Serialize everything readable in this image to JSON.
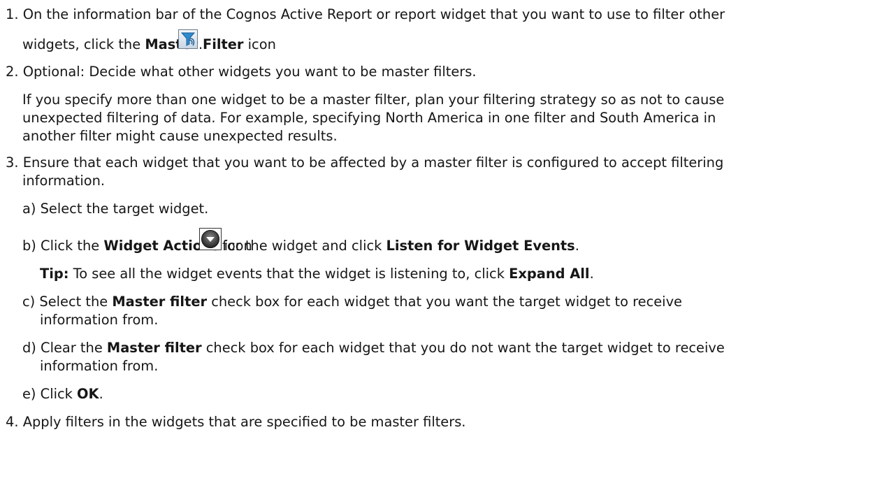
{
  "steps": {
    "s1": {
      "num": "1.",
      "line1": "On the information bar of the Cognos Active Report or report widget that you want to use to filter other",
      "line2_pre": "widgets, click the ",
      "line2_bold": "Master Filter",
      "line2_post": " icon",
      "line2_end": ".",
      "icon": "master-filter-icon"
    },
    "s2": {
      "num": "2.",
      "text": "Optional: Decide what other widgets you want to be master filters.",
      "para": [
        "If you specify more than one widget to be a master filter, plan your filtering strategy so as not to cause",
        "unexpected filtering of data. For example, specifying North America in one filter and South America in",
        "another filter might cause unexpected results."
      ]
    },
    "s3": {
      "num": "3.",
      "line1": "Ensure that each widget that you want to be affected by a master filter is configured to accept filtering",
      "line2": "information.",
      "a": {
        "label": "a)",
        "text": "Select the target widget."
      },
      "b": {
        "label": "b)",
        "pre": "Click the ",
        "bold1": "Widget Actions",
        "mid1": " icon",
        "mid2": " for the widget and click ",
        "bold2": "Listen for Widget Events",
        "end": ".",
        "icon": "widget-actions-icon"
      },
      "tip": {
        "label": "Tip:",
        "text": " To see all the widget events that the widget is listening to, click ",
        "bold": "Expand All",
        "end": "."
      },
      "c": {
        "label": "c)",
        "pre": "Select the ",
        "bold": "Master filter",
        "post": " check box for each widget that you want the target widget to receive",
        "line2": "information from."
      },
      "d": {
        "label": "d)",
        "pre": "Clear the ",
        "bold": "Master filter",
        "post": " check box for each widget that you do not want the target widget to receive",
        "line2": "information from."
      },
      "e": {
        "label": "e)",
        "pre": "Click ",
        "bold": "OK",
        "end": "."
      }
    },
    "s4": {
      "num": "4.",
      "text": "Apply filters in the widgets that are specified to be master filters."
    }
  }
}
